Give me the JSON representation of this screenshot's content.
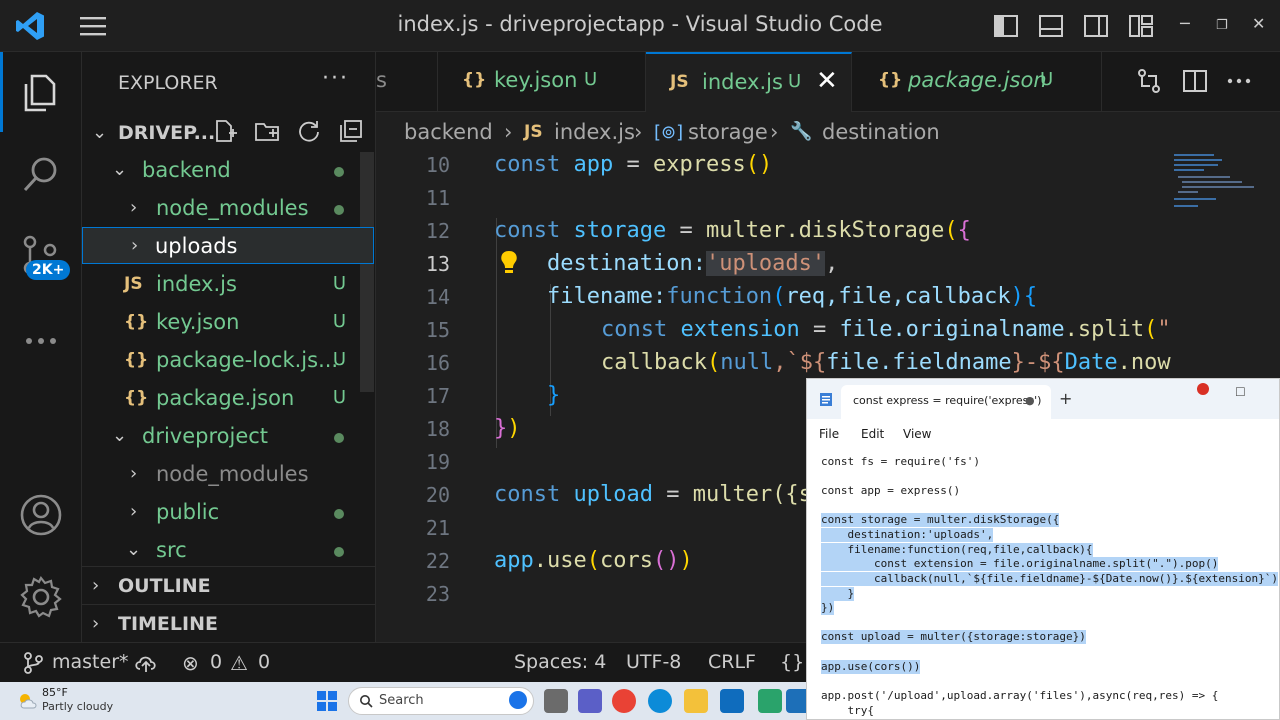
{
  "window": {
    "title": "index.js - driveprojectapp - Visual Studio Code"
  },
  "activity": {
    "badge": "2K+"
  },
  "sidebar": {
    "title": "EXPLORER",
    "more": "···",
    "root": "DRIVEP...",
    "tree": [
      {
        "label": "backend",
        "status": ""
      },
      {
        "label": "node_modules",
        "status": ""
      },
      {
        "label": "uploads",
        "status": ""
      },
      {
        "label": "index.js",
        "icon": "JS",
        "status": "U"
      },
      {
        "label": "key.json",
        "icon": "{}",
        "status": "U"
      },
      {
        "label": "package-lock.js...",
        "icon": "{}",
        "status": "U"
      },
      {
        "label": "package.json",
        "icon": "{}",
        "status": "U"
      },
      {
        "label": "driveproject",
        "status": ""
      },
      {
        "label": "node_modules",
        "status": ""
      },
      {
        "label": "public",
        "status": ""
      },
      {
        "label": "src",
        "status": ""
      }
    ],
    "outline": "OUTLINE",
    "timeline": "TIMELINE"
  },
  "tabs": [
    {
      "partial": "s"
    },
    {
      "icon": "{}",
      "name": "key.json",
      "status": "U"
    },
    {
      "icon": "JS",
      "name": "index.js",
      "status": "U",
      "close": "✕"
    },
    {
      "icon": "{}",
      "name": "package.json",
      "status": "U"
    }
  ],
  "breadcrumb": {
    "folder": "backend",
    "sep": "›",
    "file_icon": "JS",
    "file": "index.js",
    "symbol_icon": "[⊚]",
    "symbol": "storage",
    "prop_icon": "🔧",
    "prop": "destination"
  },
  "editor": {
    "line_numbers": [
      "10",
      "11",
      "12",
      "13",
      "14",
      "15",
      "16",
      "17",
      "18",
      "19",
      "20",
      "21",
      "22",
      "23"
    ],
    "tokens": {
      "const": "const",
      "app": "app",
      "eq": " = ",
      "express": "express",
      "storage": "storage",
      "multer": "multer",
      "disk": ".diskStorage",
      "destination": "destination:",
      "uploads_str": "'uploads'",
      "comma": ",",
      "filename": "filename:",
      "function": "function",
      "params": "req,file,callback",
      "extension": "extension",
      "file": "file",
      "originalname": ".originalname",
      "split": ".split",
      "quote_open": "\"",
      "callback": "callback",
      "null": "null",
      "tpl": ",`${",
      "fieldname": "file.fieldname",
      "tpl2": "}-${",
      "date": "Date",
      "now": ".now",
      "close_brace": "}",
      "close_brace_paren": "})",
      "upload": "upload",
      "multer_partial": "multer({s",
      "app_use": "app",
      "use": ".use",
      "cors": "cors"
    }
  },
  "status": {
    "branch": "master*",
    "errors": "0",
    "warnings": "0",
    "spaces": "Spaces: 4",
    "encoding": "UTF-8",
    "eol": "CRLF",
    "lang": "{}"
  },
  "taskbar": {
    "temp": "85°F",
    "weather": "Partly cloudy",
    "search_placeholder": "Search"
  },
  "notepad": {
    "tab_title": "const express = require('express')",
    "tab_dot": "●",
    "add": "+",
    "menu": [
      "File",
      "Edit",
      "View"
    ],
    "lines": [
      "const fs = require('fs')",
      "",
      "const app = express()",
      "",
      "const storage = multer.diskStorage({",
      "    destination:'uploads',",
      "    filename:function(req,file,callback){",
      "        const extension = file.originalname.split(\".\").pop()",
      "        callback(null,`${file.fieldname}-${Date.now()}.${extension}`)",
      "    }",
      "})",
      "",
      "const upload = multer({storage:storage})",
      "",
      "app.use(cors())",
      "",
      "app.post('/upload',upload.array('files'),async(req,res) => {",
      "    try{"
    ]
  },
  "colors": {
    "accent": "#0078d4",
    "untracked": "#73c991",
    "folder": "#73c991"
  }
}
